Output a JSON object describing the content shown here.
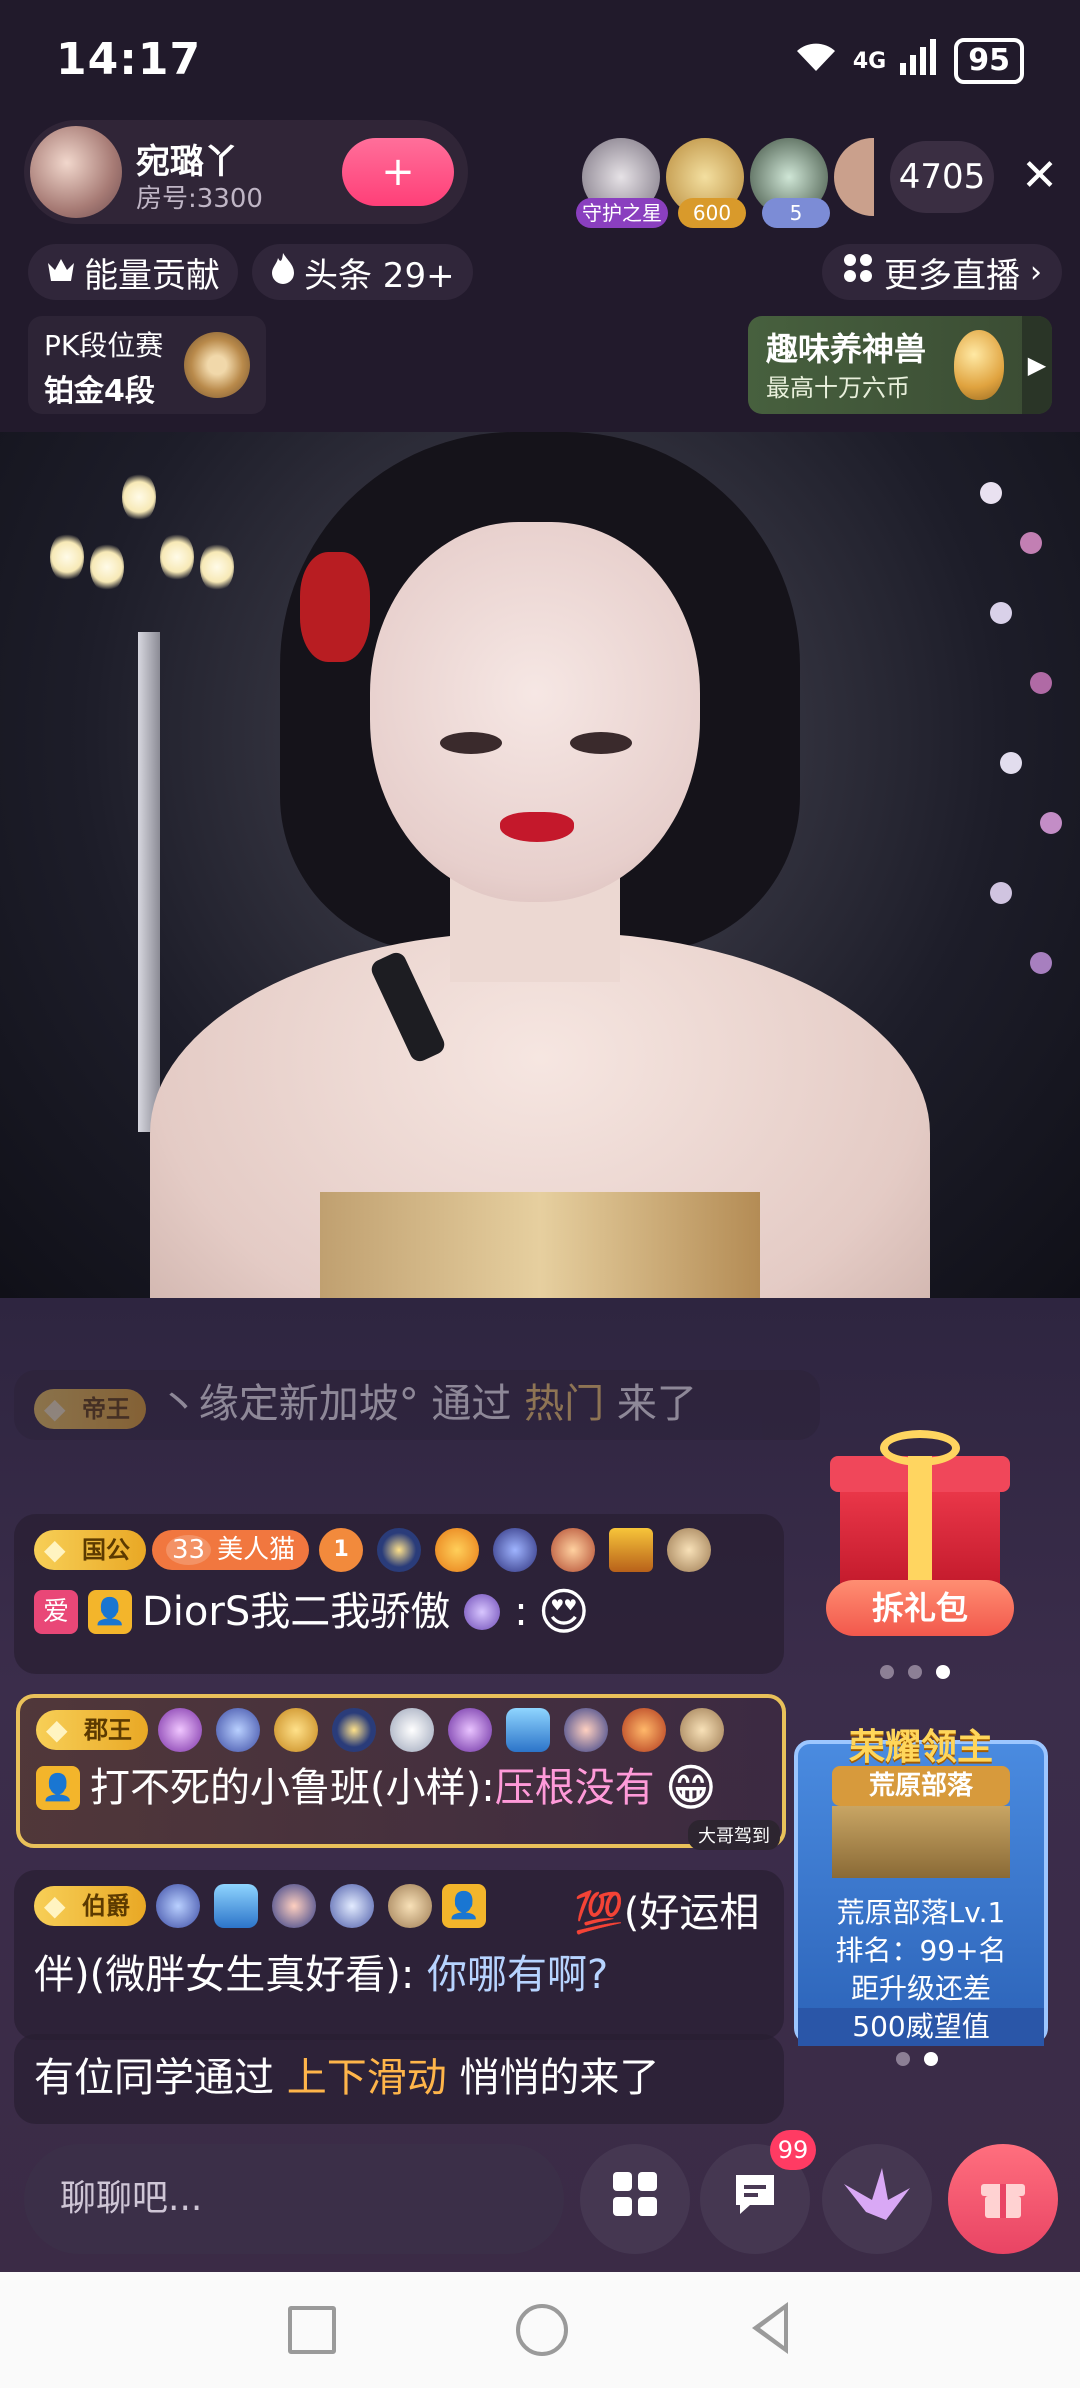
{
  "status_bar": {
    "time": "14:17",
    "network": "4G",
    "battery": "95"
  },
  "header": {
    "anchor_name": "宛璐丫",
    "room_number": "房号:3300",
    "follow_symbol": "+",
    "viewer_badges": [
      "守护之星",
      "600",
      "5"
    ],
    "viewer_count": "4705",
    "close_symbol": "✕"
  },
  "chips": {
    "energy": "能量贡献",
    "headline": "头条 29+",
    "more_live": "更多直播"
  },
  "pk": {
    "title": "PK段位赛",
    "rank": "铂金4段"
  },
  "beast": {
    "title": "趣味养神兽",
    "subtitle": "最高十万六币"
  },
  "chat": {
    "msg0": {
      "rank": "帝王",
      "text_a": "丶缘定新加坡°  通过 ",
      "text_b": "热门",
      "text_c": " 来了"
    },
    "msg1": {
      "rank": "国公",
      "level": "33",
      "nick_tag": "美人猫",
      "badge_num": "1",
      "love_tag": "爱",
      "user": "DiorS我二我骄傲",
      "colon": " :"
    },
    "msg2": {
      "rank": "郡王",
      "user": "打不死的小鲁班(小样): ",
      "content": "压根没有",
      "bubble": "大哥驾到"
    },
    "msg3": {
      "rank": "伯爵",
      "user": "💯(好运相伴)(微胖女生真好看): ",
      "content": "你哪有啊?"
    },
    "msg4": {
      "text_a": "有位同学通过 ",
      "text_b": "上下滑动",
      "text_c": " 悄悄的来了"
    }
  },
  "gift_widget": {
    "button": "拆礼包"
  },
  "honor_widget": {
    "title": "荣耀领主",
    "tribe": "荒原部落",
    "level_line": "荒原部落Lv.1",
    "rank_line": "排名：99+名",
    "upgrade_line": "距升级还差",
    "prestige_line": "500威望值"
  },
  "input_bar": {
    "placeholder": "聊聊吧...",
    "message_badge": "99"
  },
  "colors": {
    "accent_pink": "#ff3f78",
    "rank_gold": "#f7cf57",
    "highlight_yellow": "#ffd36a",
    "highlight_pink": "#ff9ad9"
  }
}
